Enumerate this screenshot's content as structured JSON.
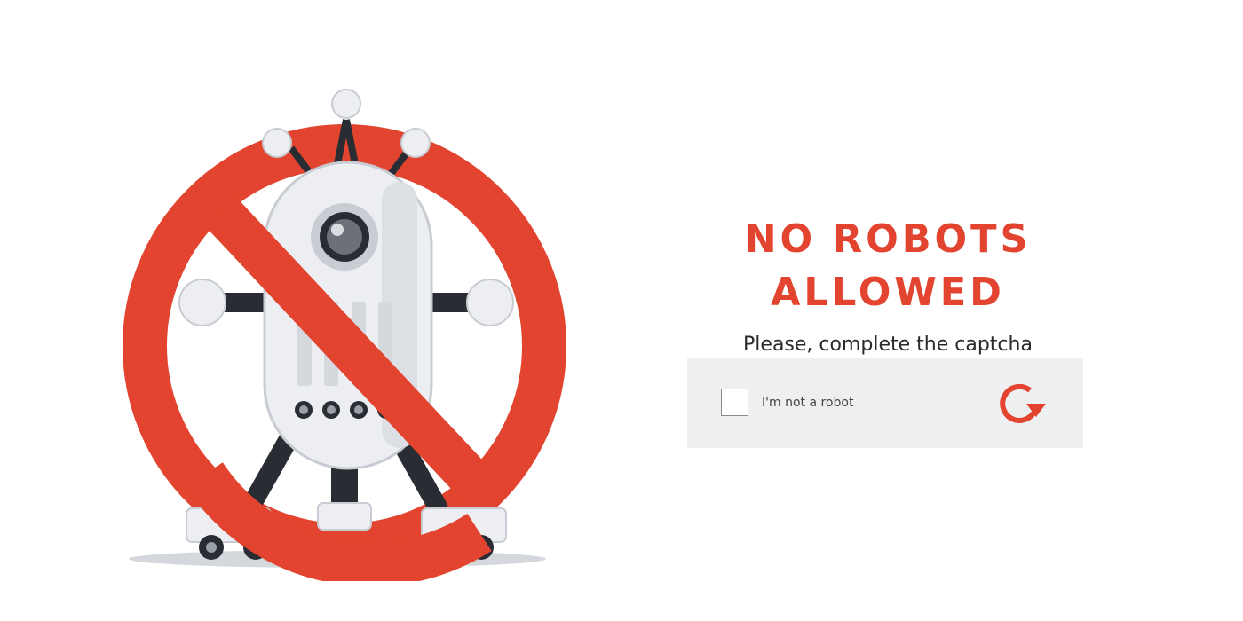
{
  "hero": {
    "illustration_icon": "no-robots-prohibited-robot-icon",
    "prohibition_color": "#e2442f",
    "robot_body_color": "#e8eaed",
    "robot_dark_color": "#2a2c33"
  },
  "message": {
    "title": "NO ROBOTS ALLOWED",
    "subtitle": "Please, complete the captcha"
  },
  "captcha": {
    "checkbox_label": "I'm not a robot",
    "checked": false,
    "refresh_icon": "refresh-icon",
    "accent_color": "#e2442f",
    "background_color": "#eeeff0"
  }
}
